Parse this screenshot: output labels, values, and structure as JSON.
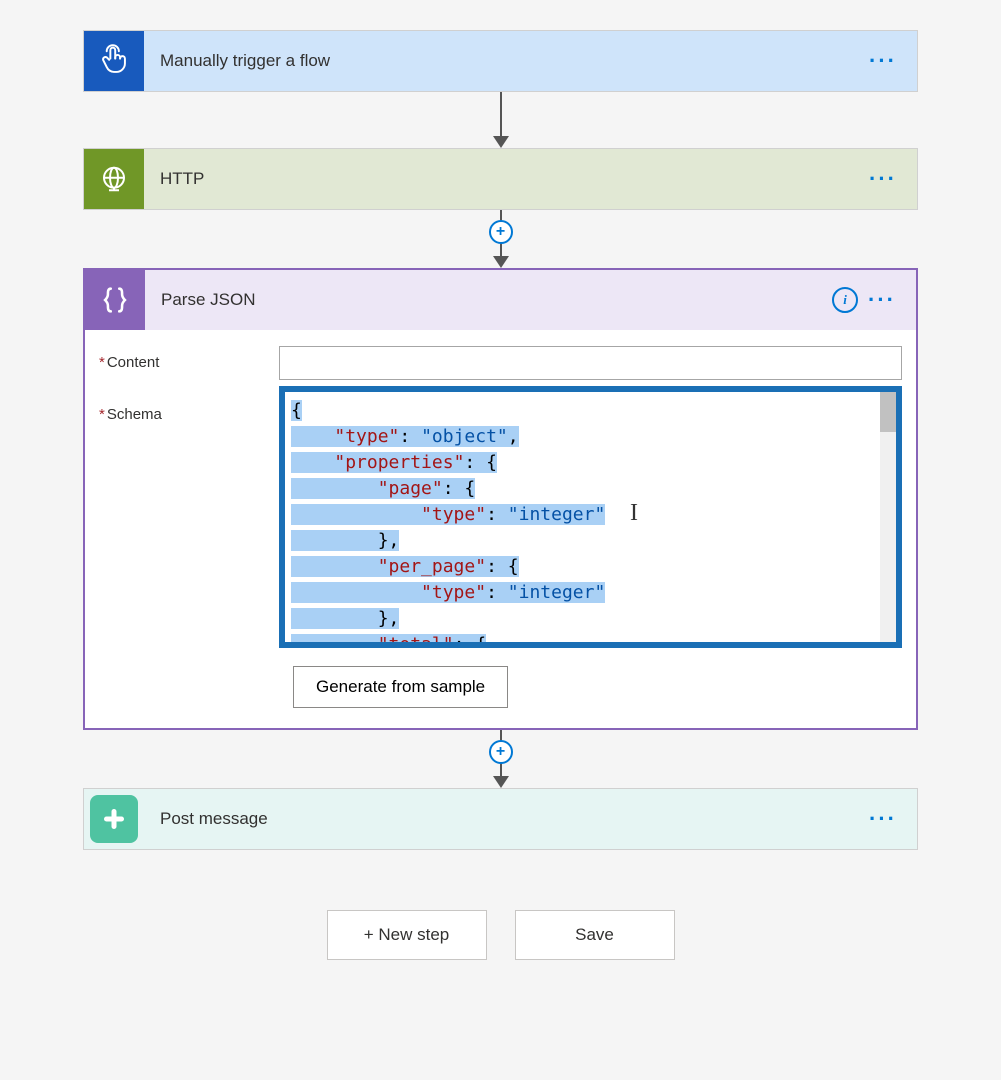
{
  "steps": {
    "trigger": {
      "title": "Manually trigger a flow"
    },
    "http": {
      "title": "HTTP"
    },
    "parsejson": {
      "title": "Parse JSON",
      "fields": {
        "content_label": "Content",
        "schema_label": "Schema"
      },
      "generate_btn": "Generate from sample",
      "schema_lines": [
        {
          "indent": 0,
          "tokens": [
            {
              "t": "{",
              "c": "p"
            }
          ]
        },
        {
          "indent": 1,
          "tokens": [
            {
              "t": "\"type\"",
              "c": "k"
            },
            {
              "t": ": ",
              "c": "p"
            },
            {
              "t": "\"object\"",
              "c": "s"
            },
            {
              "t": ",",
              "c": "p"
            }
          ]
        },
        {
          "indent": 1,
          "tokens": [
            {
              "t": "\"properties\"",
              "c": "k"
            },
            {
              "t": ": {",
              "c": "p"
            }
          ]
        },
        {
          "indent": 2,
          "tokens": [
            {
              "t": "\"page\"",
              "c": "k"
            },
            {
              "t": ": {",
              "c": "p"
            }
          ]
        },
        {
          "indent": 3,
          "tokens": [
            {
              "t": "\"type\"",
              "c": "k"
            },
            {
              "t": ": ",
              "c": "p"
            },
            {
              "t": "\"integer\"",
              "c": "s"
            }
          ]
        },
        {
          "indent": 2,
          "tokens": [
            {
              "t": "},",
              "c": "p"
            }
          ]
        },
        {
          "indent": 2,
          "tokens": [
            {
              "t": "\"per_page\"",
              "c": "k"
            },
            {
              "t": ": {",
              "c": "p"
            }
          ]
        },
        {
          "indent": 3,
          "tokens": [
            {
              "t": "\"type\"",
              "c": "k"
            },
            {
              "t": ": ",
              "c": "p"
            },
            {
              "t": "\"integer\"",
              "c": "s"
            }
          ]
        },
        {
          "indent": 2,
          "tokens": [
            {
              "t": "},",
              "c": "p"
            }
          ]
        },
        {
          "indent": 2,
          "tokens": [
            {
              "t": "\"total\"",
              "c": "k"
            },
            {
              "t": ": {",
              "c": "p"
            }
          ]
        }
      ]
    },
    "postmsg": {
      "title": "Post message"
    }
  },
  "footer": {
    "new_step": "+ New step",
    "save": "Save"
  }
}
